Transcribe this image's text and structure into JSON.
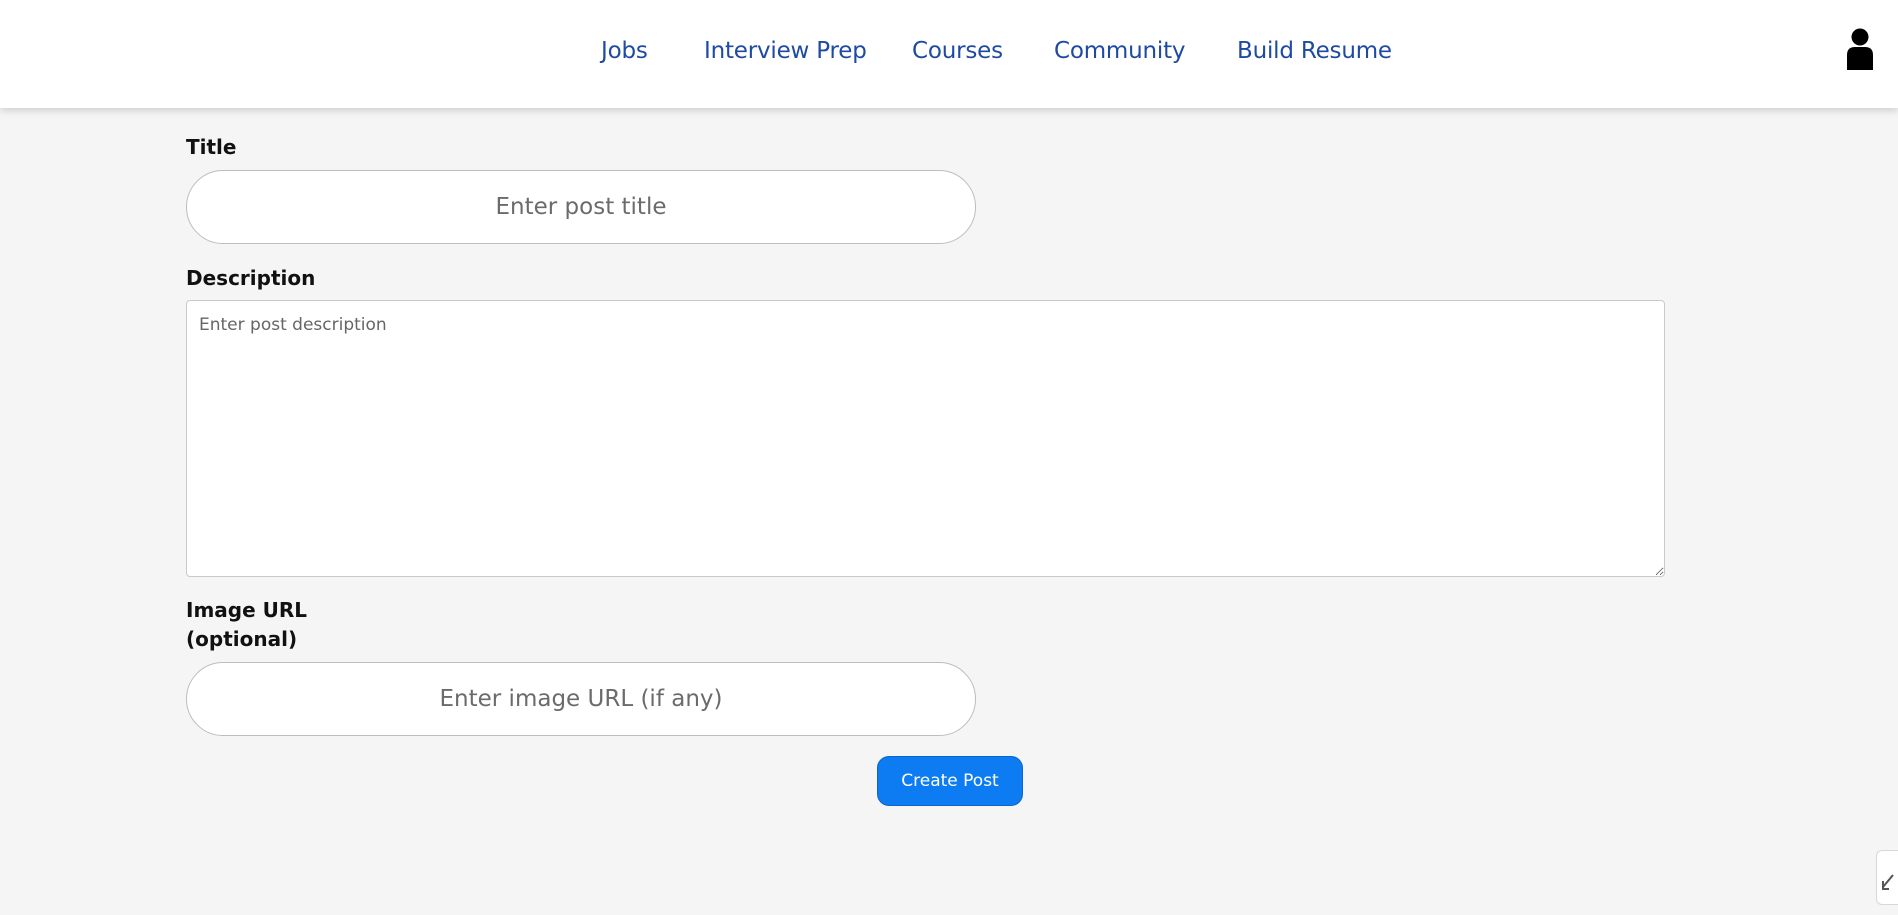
{
  "nav": {
    "items": [
      {
        "label": "Jobs"
      },
      {
        "label": "Interview Prep"
      },
      {
        "label": "Courses"
      },
      {
        "label": "Community"
      },
      {
        "label": "Build Resume"
      }
    ],
    "profile_icon": "user-icon",
    "link_color": "#1f4aa2"
  },
  "form": {
    "title_label": "Title",
    "title_placeholder": "Enter post title",
    "title_value": "",
    "description_label": "Description",
    "description_placeholder": "Enter post description",
    "description_value": "",
    "image_label_line1": "Image URL",
    "image_label_line2": "(optional)",
    "image_placeholder": "Enter image URL (if any)",
    "image_value": "",
    "submit_label": "Create Post"
  },
  "colors": {
    "accent": "#0d7cf2",
    "background": "#f5f5f5",
    "header": "#ffffff"
  },
  "side_tab_icon": "edit-icon"
}
